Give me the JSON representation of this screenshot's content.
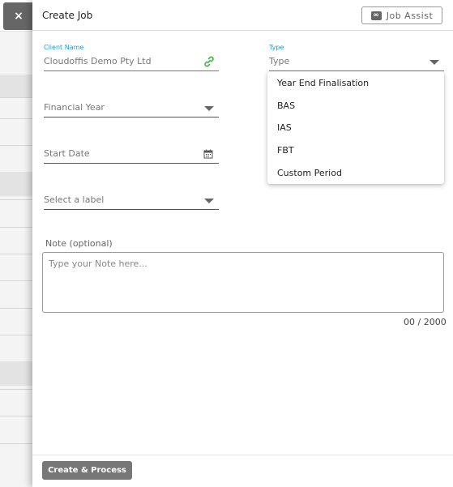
{
  "window": {
    "close_label": "×"
  },
  "header": {
    "title": "Create Job",
    "assist_icon": "∞",
    "assist_label": "Job Assist"
  },
  "form": {
    "client": {
      "label": "Client Name",
      "value": "Cloudoffis Demo Pty Ltd",
      "icon": "link-icon"
    },
    "type": {
      "label": "Type",
      "placeholder": "Type",
      "options": [
        "Year End Finalisation",
        "BAS",
        "IAS",
        "FBT",
        "Custom Period"
      ]
    },
    "financial_year": {
      "placeholder": "Financial Year"
    },
    "start_date": {
      "placeholder": "Start Date",
      "icon": "calendar-icon"
    },
    "label_select": {
      "placeholder": "Select a label"
    },
    "note": {
      "label": "Note (optional)",
      "placeholder": "Type your Note here...",
      "counter": "00 / 2000"
    }
  },
  "footer": {
    "submit_label": "Create & Process"
  },
  "colors": {
    "accent": "#1e9bd7",
    "link_icon": "#4caf50",
    "button": "#777777"
  }
}
